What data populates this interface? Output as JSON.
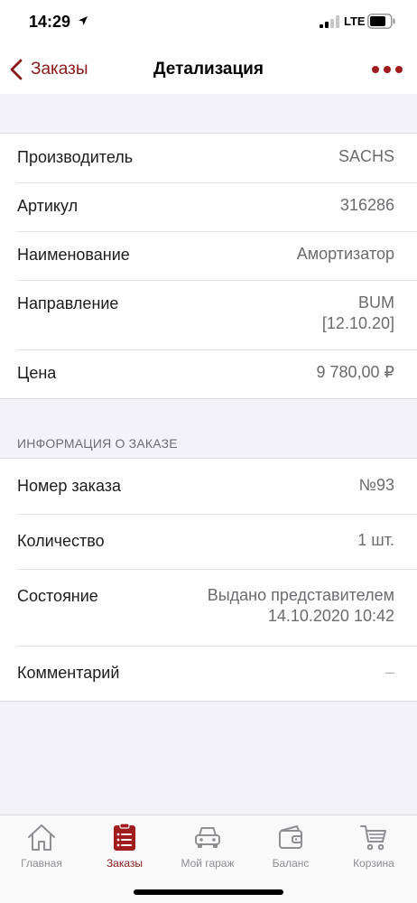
{
  "status_bar": {
    "time": "14:29",
    "network": "LTE"
  },
  "nav": {
    "back_label": "Заказы",
    "title": "Детализация"
  },
  "details": {
    "manufacturer": {
      "label": "Производитель",
      "value": "SACHS"
    },
    "article": {
      "label": "Артикул",
      "value": "316286"
    },
    "name": {
      "label": "Наименование",
      "value": "Амортизатор"
    },
    "direction": {
      "label": "Направление",
      "value_line1": "BUM",
      "value_line2": "[12.10.20]"
    },
    "price": {
      "label": "Цена",
      "value": "9 780,00 ₽"
    }
  },
  "order_info": {
    "section_title": "ИНФОРМАЦИЯ О ЗАКАЗЕ",
    "order_number": {
      "label": "Номер заказа",
      "value": "№93"
    },
    "quantity": {
      "label": "Количество",
      "value": "1 шт."
    },
    "state": {
      "label": "Состояние",
      "value_line1": "Выдано представителем",
      "value_line2": "14.10.2020 10:42"
    },
    "comment": {
      "label": "Комментарий",
      "value": "–"
    }
  },
  "tabs": [
    {
      "label": "Главная",
      "icon": "home-icon"
    },
    {
      "label": "Заказы",
      "icon": "orders-icon"
    },
    {
      "label": "Мой гараж",
      "icon": "car-icon"
    },
    {
      "label": "Баланс",
      "icon": "wallet-icon"
    },
    {
      "label": "Корзина",
      "icon": "cart-icon"
    }
  ],
  "colors": {
    "accent": "#8b1a1a",
    "inactive": "#8e8e93",
    "background": "#f2f2f7"
  }
}
